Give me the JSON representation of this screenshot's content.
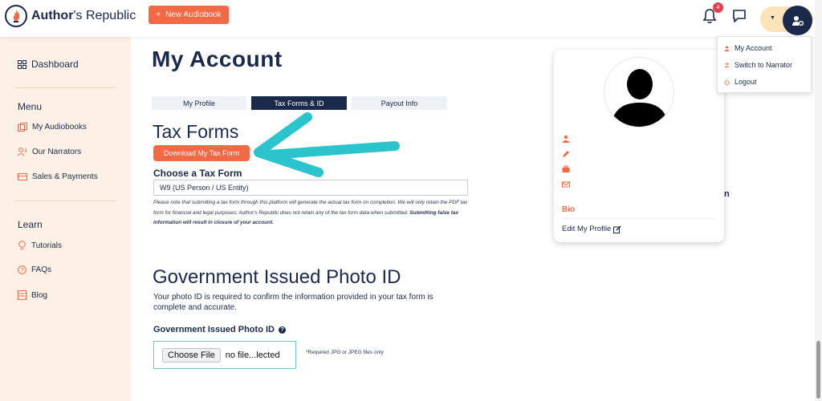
{
  "brand": {
    "name_bold": "Author",
    "name_rest": "'s Republic",
    "accent": "#f26a45",
    "navy": "#1b2a4a"
  },
  "header": {
    "new_audiobook_label": "New Audiobook",
    "new_audiobook_icon": "+",
    "notification_count": "4"
  },
  "user_menu": {
    "items": [
      {
        "label": "My Account",
        "icon": "person-icon"
      },
      {
        "label": "Switch to Narrator",
        "icon": "switch-icon"
      },
      {
        "label": "Logout",
        "icon": "power-icon"
      }
    ]
  },
  "sidebar": {
    "dashboard_label": "Dashboard",
    "menu_heading": "Menu",
    "menu_items": [
      {
        "label": "My Audiobooks",
        "icon": "audiobooks-icon"
      },
      {
        "label": "Our Narrators",
        "icon": "narrators-icon"
      },
      {
        "label": "Sales & Payments",
        "icon": "payments-icon"
      }
    ],
    "learn_heading": "Learn",
    "learn_items": [
      {
        "label": "Tutorials",
        "icon": "lightbulb-icon"
      },
      {
        "label": "FAQs",
        "icon": "question-icon"
      },
      {
        "label": "Blog",
        "icon": "blog-icon"
      }
    ]
  },
  "main": {
    "title": "My Account",
    "tabs": [
      {
        "label": "My Profile",
        "active": false
      },
      {
        "label": "Tax Forms & ID",
        "active": true
      },
      {
        "label": "Payout Info",
        "active": false
      }
    ],
    "tax_heading": "Tax Forms",
    "download_label": "Download My Tax Form",
    "choose_label": "Choose a Tax Form",
    "selected_form": "W9 (US Person / US Entity)",
    "note_text": "Please note that submitting a tax form through this platform will generate the actual tax form on completion. We will only retain the PDF tax form for financial and legal purposes; Author's Republic does not retain any of the tax form data when submitted.",
    "note_bold": "Submitting false tax information will result in closure of your account.",
    "gov_heading": "Government Issued Photo ID",
    "gov_desc": "Your photo ID is required to confirm the information provided in your tax form is complete and accurate.",
    "gov_label": "Government Issued Photo ID",
    "help_symbol": "?",
    "choose_file_label": "Choose File",
    "file_name": "no file...lected",
    "file_hint": "*Required JPG or JPEG files only"
  },
  "profile_card": {
    "bio_label": "Bio",
    "edit_label": "Edit My Profile",
    "stray_text": "n"
  }
}
